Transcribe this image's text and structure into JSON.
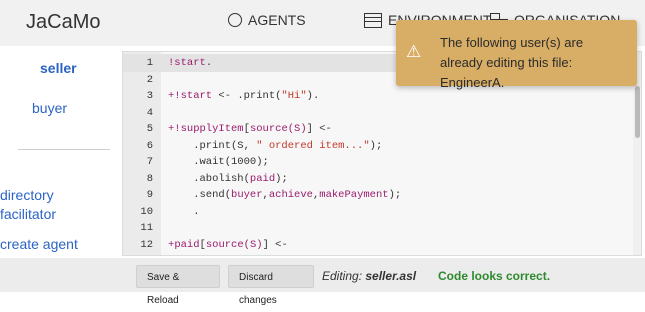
{
  "app": {
    "title": "JaCaMo"
  },
  "nav": {
    "agents": "AGENTS",
    "environment": "ENVIRONMENT",
    "organisation": "ORGANISATION"
  },
  "sidebar": {
    "agents": [
      "seller",
      "buyer"
    ],
    "directory": "directory\nfacilitator",
    "create": "create agent"
  },
  "editor": {
    "lines": [
      {
        "n": "1",
        "text": "!start."
      },
      {
        "n": "2",
        "text": ""
      },
      {
        "n": "3",
        "text": "+!start <- .print(\"Hi\")."
      },
      {
        "n": "4",
        "text": ""
      },
      {
        "n": "5",
        "text": "+!supplyItem[source(S)] <-"
      },
      {
        "n": "6",
        "text": "    .print(S, \" ordered item...\");"
      },
      {
        "n": "7",
        "text": "    .wait(1000);"
      },
      {
        "n": "8",
        "text": "    .abolish(paid);"
      },
      {
        "n": "9",
        "text": "    .send(buyer,achieve,makePayment);"
      },
      {
        "n": "10",
        "text": "    ."
      },
      {
        "n": "11",
        "text": ""
      },
      {
        "n": "12",
        "text": "+paid[source(S)] <-"
      }
    ]
  },
  "toast": {
    "icon": "warning-icon",
    "message": "The following user(s) are already editing this file: EngineerA."
  },
  "footer": {
    "save_label": "Save & Reload",
    "discard_label": "Discard changes",
    "editing_prefix": "Editing:",
    "editing_file": "seller.asl",
    "status": "Code looks correct."
  },
  "colors": {
    "accent": "#2b64c6",
    "toast_bg": "#d8ad66",
    "status_ok": "#2e8a2e",
    "keyword": "#9a1b6d"
  }
}
